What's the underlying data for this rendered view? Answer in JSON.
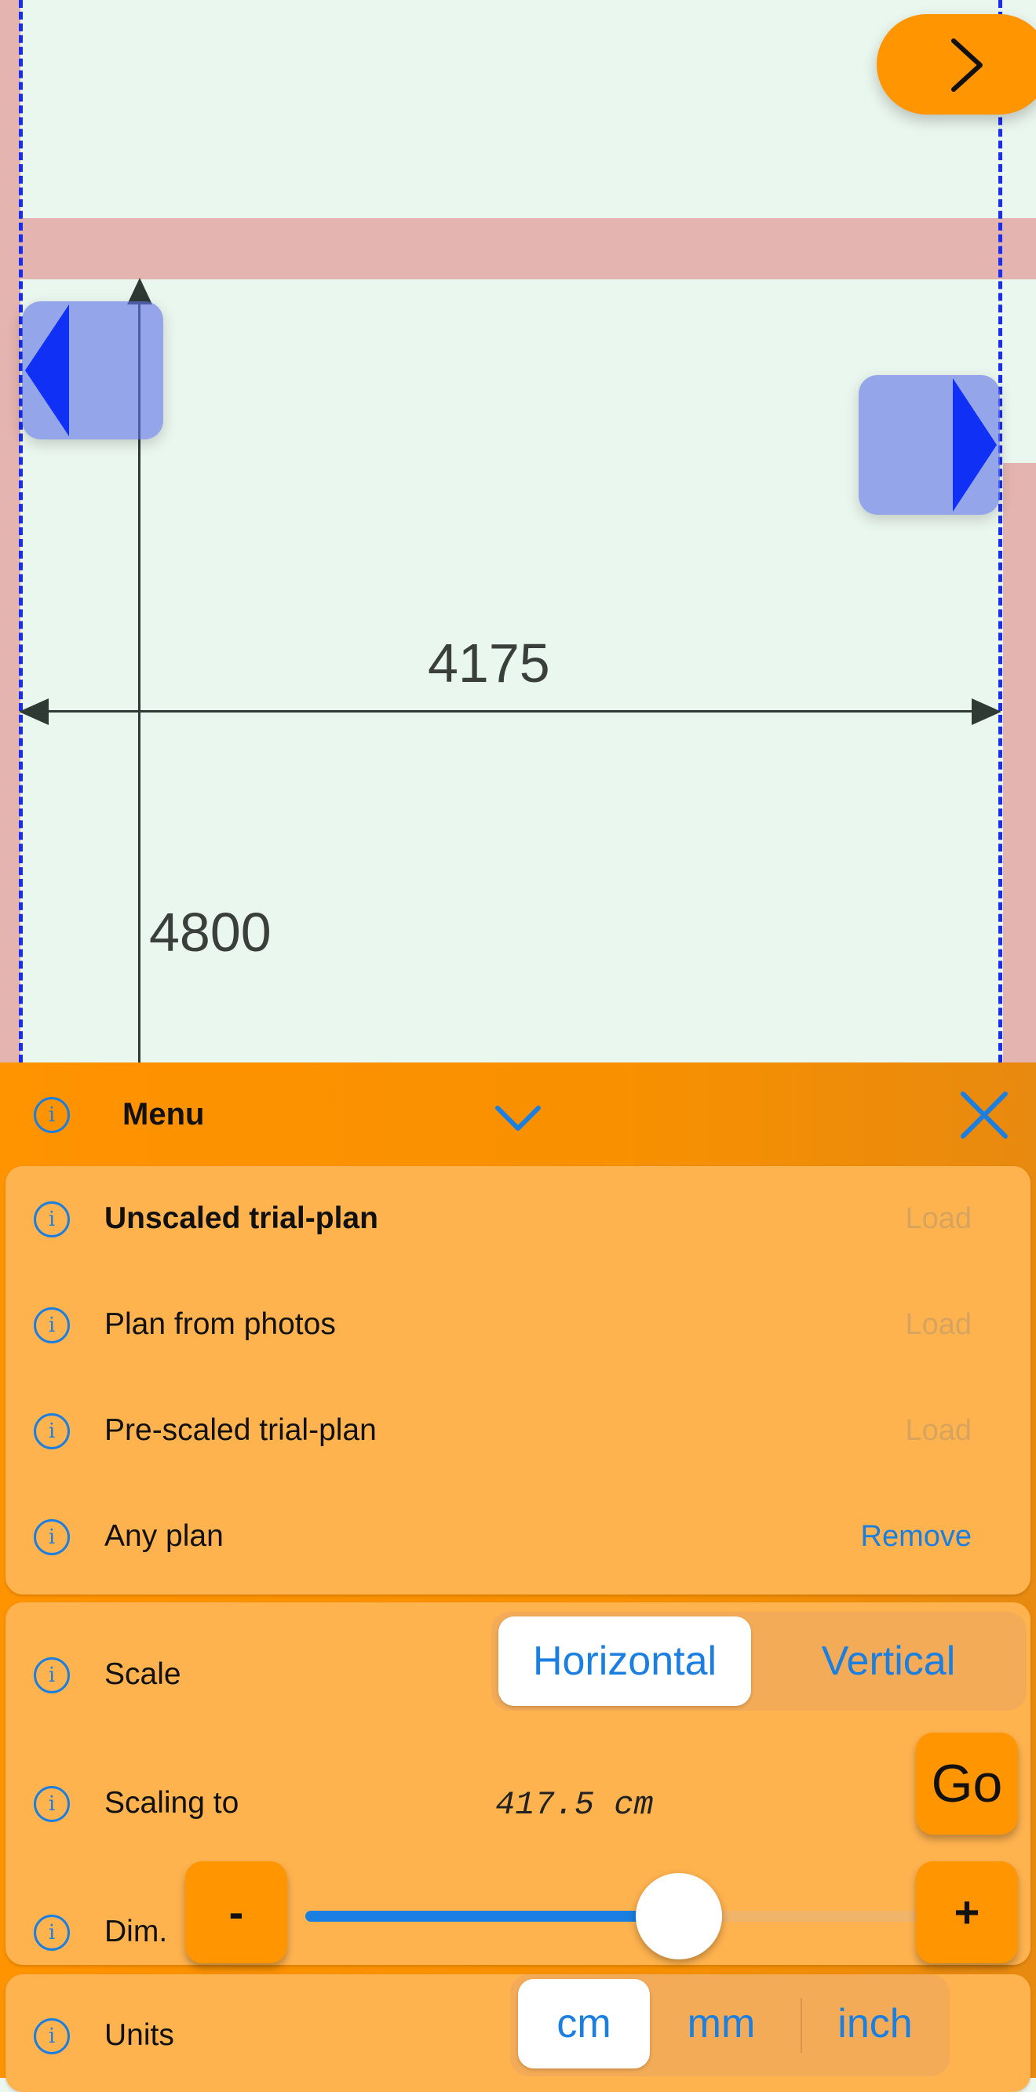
{
  "plan": {
    "horizontal_dimension": "4175",
    "vertical_dimension": "4800"
  },
  "menu": {
    "title": "Menu",
    "plans": [
      {
        "label": "Unscaled trial-plan",
        "action": "Load",
        "action_enabled": false
      },
      {
        "label": "Plan from photos",
        "action": "Load",
        "action_enabled": false
      },
      {
        "label": "Pre-scaled trial-plan",
        "action": "Load",
        "action_enabled": false
      },
      {
        "label": "Any plan",
        "action": "Remove",
        "action_enabled": true
      }
    ],
    "scale": {
      "label": "Scale",
      "options": [
        "Horizontal",
        "Vertical"
      ],
      "selected": "Horizontal"
    },
    "scaling_to": {
      "label": "Scaling to",
      "value": "417.5 cm",
      "go_label": "Go"
    },
    "dim": {
      "label": "Dim.",
      "minus_label": "-",
      "plus_label": "+",
      "slider_value_fraction": 0.61
    },
    "units": {
      "label": "Units",
      "options": [
        "cm",
        "mm",
        "inch"
      ],
      "selected": "cm"
    }
  },
  "colors": {
    "accent": "#ff9500",
    "card": "#ffb34f",
    "link": "#1a7fe0",
    "wall": "#e3b4b0",
    "floor": "#eaf7ee",
    "guide": "#1a2cf0"
  }
}
